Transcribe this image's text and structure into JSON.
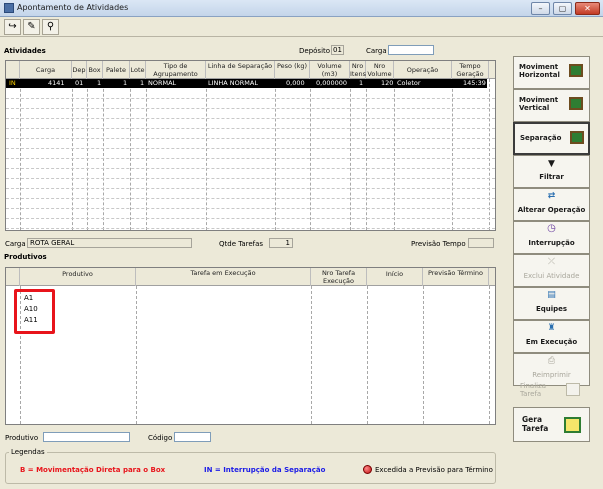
{
  "window": {
    "title": "Apontamento de Atividades",
    "min_glyph": "–",
    "max_glyph": "▢",
    "close_glyph": "✕"
  },
  "toolbar": [
    {
      "name": "enter-icon",
      "glyph": "↪"
    },
    {
      "name": "pencil-icon",
      "glyph": "✎"
    },
    {
      "name": "binoculars-icon",
      "glyph": "⚲"
    }
  ],
  "atividades": {
    "title": "Atividades",
    "deposito_label": "Depósito",
    "deposito_value": "01",
    "carga_label": "Carga",
    "carga_value": "",
    "columns": [
      "Carga",
      "Dep",
      "Box",
      "Palete",
      "Lote",
      "Tipo de Agrupamento",
      "Linha de Separação",
      "Peso (kg)",
      "Volume (m3)",
      "Nro Itens",
      "Nro Volume",
      "Operação",
      "Tempo Geração"
    ],
    "rows": [
      {
        "status": "IN",
        "carga": "4141",
        "dep": "01",
        "box": "1",
        "palete": "1",
        "lote": "1",
        "tipo": "NORMAL",
        "linha": "LINHA NORMAL",
        "peso": "0,000",
        "volume": "0,000000",
        "itens": "1",
        "nvolume": "120",
        "operacao": "Coletor",
        "tempo": "145:39"
      }
    ]
  },
  "info": {
    "carga_label": "Carga",
    "carga_value": "ROTA GERAL",
    "qtde_label": "Qtde Tarefas",
    "qtde_value": "1",
    "previsao_label": "Previsão Tempo",
    "previsao_value": ""
  },
  "produtivos": {
    "title": "Produtivos",
    "columns": [
      "Produtivo",
      "Tarefa em Execução",
      "Nro Tarefa Execução",
      "Início",
      "Previsão Término"
    ],
    "rows": [
      "A1",
      "A10",
      "A11"
    ]
  },
  "footer": {
    "produtivo_label": "Produtivo",
    "produtivo_value": "",
    "codigo_label": "Código",
    "codigo_value": ""
  },
  "legendas": {
    "title": "Legendas",
    "items": [
      {
        "text": "B = Movimentação Direta para o Box",
        "color": "#e8141b"
      },
      {
        "text": "IN = Interrupção da Separação",
        "color": "#1c1ce6"
      },
      {
        "text": "Excedida a Previsão para Término",
        "color": "#000000",
        "icon": "red-dot-icon"
      }
    ]
  },
  "actions": [
    {
      "label": "Moviment Horizontal",
      "icon": "pallet-icon",
      "enabled": true,
      "selected": false
    },
    {
      "label": "Moviment Vertical",
      "icon": "pallet-icon",
      "enabled": true,
      "selected": false
    },
    {
      "label": "Separação",
      "icon": "pallet-icon",
      "enabled": true,
      "selected": true
    },
    {
      "label": "Filtrar",
      "icon": "funnel-icon",
      "enabled": true,
      "selected": false
    },
    {
      "label": "Alterar Operação",
      "icon": "swap-icon",
      "enabled": true,
      "selected": false
    },
    {
      "label": "Interrupção",
      "icon": "clock-icon",
      "enabled": true,
      "selected": false
    },
    {
      "label": "Exclui Atividade",
      "icon": "delete-icon",
      "enabled": false,
      "selected": false
    },
    {
      "label": "Equipes",
      "icon": "team-icon",
      "enabled": true,
      "selected": false
    },
    {
      "label": "Em Execução",
      "icon": "worker-icon",
      "enabled": true,
      "selected": false
    },
    {
      "label": "Reimprimir",
      "icon": "print-icon",
      "enabled": false,
      "selected": false
    },
    {
      "label": "Finaliza Tarefa",
      "icon": "document-icon",
      "enabled": false,
      "selected": false
    },
    {
      "label": "Gera Tarefa",
      "icon": "clipboard-icon",
      "enabled": true,
      "selected": false
    }
  ],
  "colors": {
    "accent": "#000000",
    "highlight": "#e8141b",
    "in_color": "#1c1ce6"
  }
}
